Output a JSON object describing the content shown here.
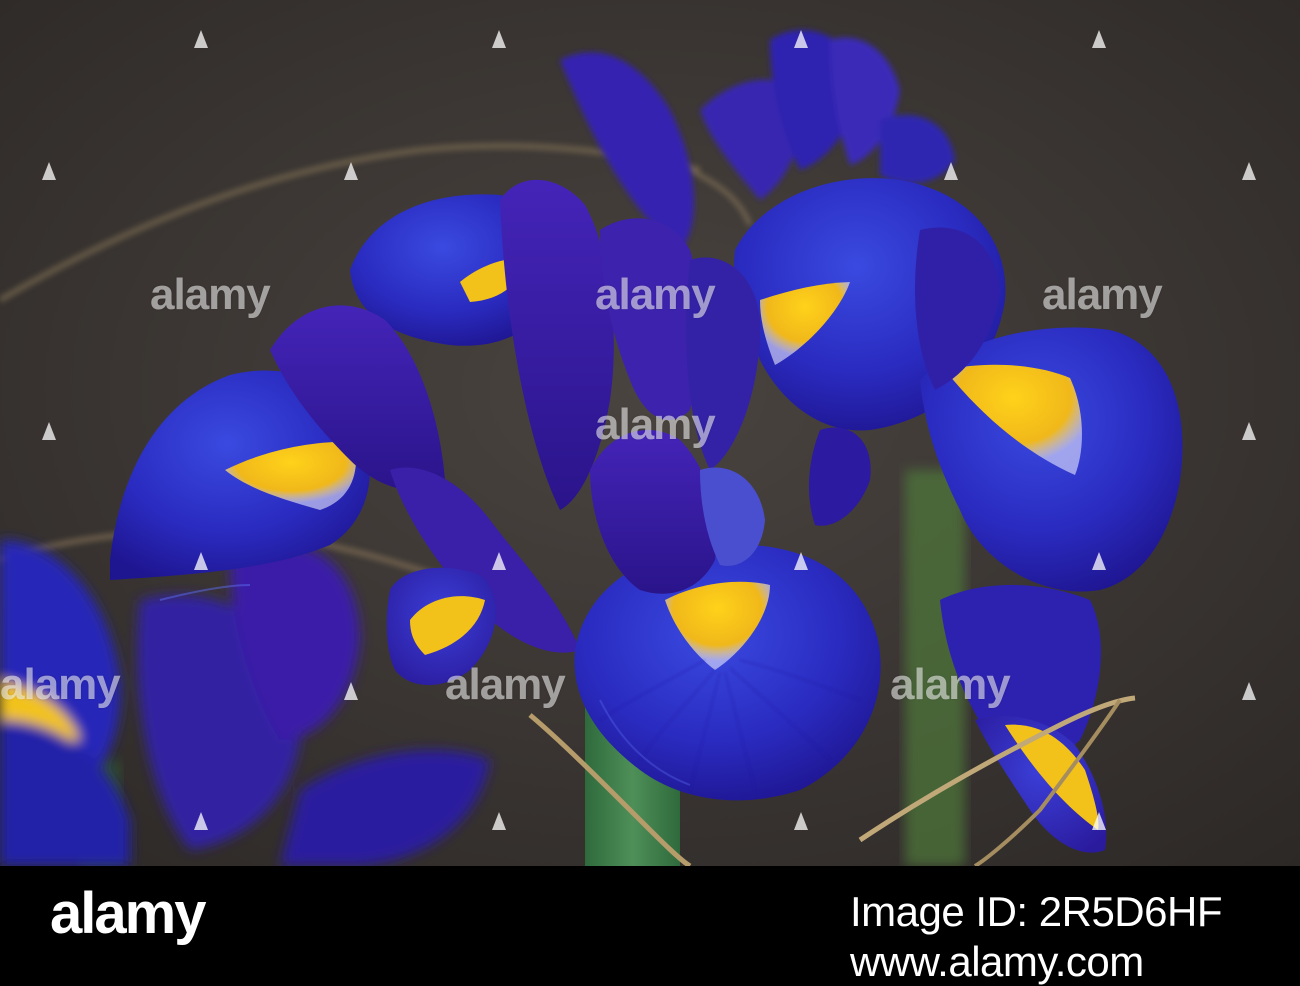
{
  "watermark": {
    "text": "alamy"
  },
  "footer": {
    "logo": "alamy",
    "image_id_label": "Image ID:",
    "image_id": "2R5D6HF",
    "url": "www.alamy.com"
  },
  "colors": {
    "background": "#3b3633",
    "petal_deep": "#2a1fb0",
    "petal_bright": "#2b3ad6",
    "petal_violet": "#3a1a9a",
    "signal_yellow": "#f2c21a",
    "stem_green": "#3f7b4a",
    "straw": "#b59c6a"
  }
}
